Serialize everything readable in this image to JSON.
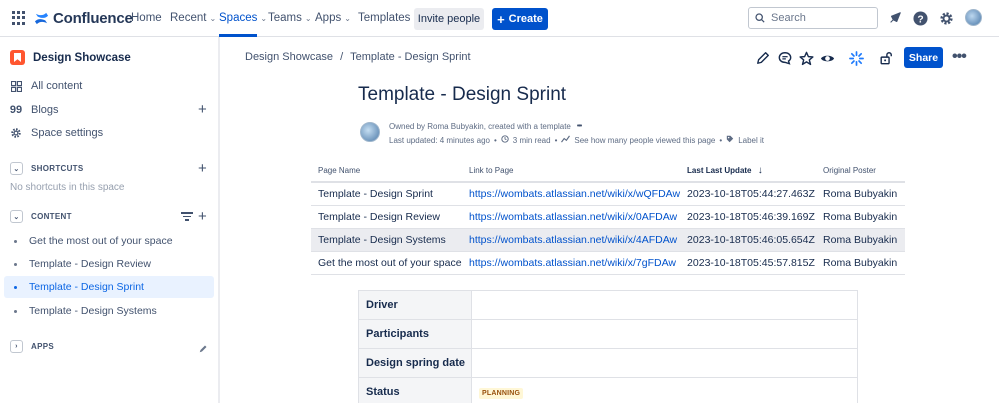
{
  "topnav": {
    "product": "Confluence",
    "items": [
      {
        "label": "Home"
      },
      {
        "label": "Recent"
      },
      {
        "label": "Spaces"
      },
      {
        "label": "Teams"
      },
      {
        "label": "Apps"
      },
      {
        "label": "Templates"
      }
    ],
    "invite_label": "Invite people",
    "create_label": "Create",
    "search_placeholder": "Search",
    "accent": "#0052cc"
  },
  "sidebar": {
    "space_name": "Design Showcase",
    "nav": [
      {
        "label": "All content"
      },
      {
        "label": "Blogs"
      },
      {
        "label": "Space settings"
      }
    ],
    "shortcuts_title": "SHORTCUTS",
    "shortcuts_empty": "No shortcuts in this space",
    "content_title": "CONTENT",
    "tree": [
      {
        "label": "Get the most out of your space"
      },
      {
        "label": "Template - Design Review"
      },
      {
        "label": "Template - Design Sprint"
      },
      {
        "label": "Template - Design Systems"
      }
    ],
    "apps_title": "APPS"
  },
  "breadcrumb": {
    "space": "Design Showcase",
    "separator": "/",
    "page": "Template - Design Sprint"
  },
  "actions": {
    "share_label": "Share"
  },
  "page": {
    "title": "Template - Design Sprint",
    "byline": "Owned by Roma Bubyakin, created with a template",
    "byline_more": "•••",
    "last_updated": "Last updated: 4 minutes ago",
    "read_time": "3 min read",
    "views": "See how many people viewed this page",
    "label_link": "Label it"
  },
  "pages_table": {
    "headers": [
      "Page Name",
      "Link to Page",
      "Last Last Update",
      "Original Poster"
    ],
    "rows": [
      {
        "name": "Template - Design Sprint",
        "link": "https://wombats.atlassian.net/wiki/x/wQFDAw",
        "updated": "2023-10-18T05:44:27.463Z",
        "poster": "Roma Bubyakin"
      },
      {
        "name": "Template - Design Review",
        "link": "https://wombats.atlassian.net/wiki/x/0AFDAw",
        "updated": "2023-10-18T05:46:39.169Z",
        "poster": "Roma Bubyakin"
      },
      {
        "name": "Template - Design Systems",
        "link": "https://wombats.atlassian.net/wiki/x/4AFDAw",
        "updated": "2023-10-18T05:46:05.654Z",
        "poster": "Roma Bubyakin"
      },
      {
        "name": "Get the most out of your space",
        "link": "https://wombats.atlassian.net/wiki/x/7gFDAw",
        "updated": "2023-10-18T05:45:57.815Z",
        "poster": "Roma Bubyakin"
      }
    ]
  },
  "props_table": {
    "rows": [
      {
        "key": "Driver",
        "value": ""
      },
      {
        "key": "Participants",
        "value": ""
      },
      {
        "key": "Design spring date",
        "value": ""
      },
      {
        "key": "Status",
        "value": "PLANNING"
      }
    ]
  }
}
